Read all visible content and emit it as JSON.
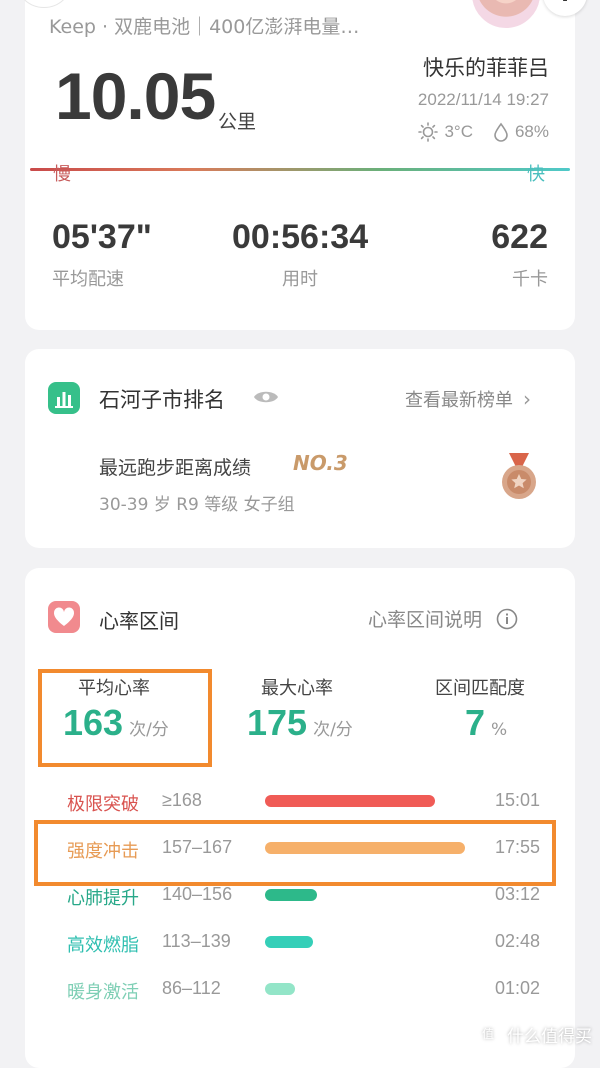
{
  "summary": {
    "sponsor": "Keep · 双鹿电池｜400亿澎湃电量…",
    "distance": "10.05",
    "distance_unit": "公里",
    "user_name": "快乐的菲菲吕",
    "datetime": "2022/11/14 19:27",
    "temperature": "3°C",
    "humidity": "68%",
    "slow_label": "慢",
    "fast_label": "快",
    "stats": [
      {
        "value": "05'37\"",
        "label": "平均配速"
      },
      {
        "value": "00:56:34",
        "label": "用时"
      },
      {
        "value": "622",
        "label": "千卡"
      }
    ]
  },
  "ranking": {
    "title": "石河子市排名",
    "link": "查看最新榜单",
    "achievement": "最远跑步距离成绩",
    "rank_no": "NO.3",
    "group": "30-39 岁 R9 等级 女子组",
    "medal_color": "#c98b6a"
  },
  "heart_rate": {
    "title": "心率区间",
    "help_link": "心率区间说明",
    "avg_label": "平均心率",
    "avg_value": "163",
    "avg_unit": "次/分",
    "max_label": "最大心率",
    "max_value": "175",
    "max_unit": "次/分",
    "match_label": "区间匹配度",
    "match_value": "7",
    "match_unit": "%",
    "zones": [
      {
        "name": "极限突破",
        "range": "≥168",
        "time": "15:01",
        "fraction": 0.85,
        "color": "#f05b56",
        "name_color": "#d9534f"
      },
      {
        "name": "强度冲击",
        "range": "157–167",
        "time": "17:55",
        "fraction": 1.0,
        "color": "#f6b06a",
        "name_color": "#e79b55"
      },
      {
        "name": "心肺提升",
        "range": "140–156",
        "time": "03:12",
        "fraction": 0.26,
        "color": "#2db98a",
        "name_color": "#28a889"
      },
      {
        "name": "高效燃脂",
        "range": "113–139",
        "time": "02:48",
        "fraction": 0.24,
        "color": "#35cfb8",
        "name_color": "#2fbfb0"
      },
      {
        "name": "暖身激活",
        "range": "86–112",
        "time": "01:02",
        "fraction": 0.15,
        "color": "#93e5c8",
        "name_color": "#7fcfb5"
      }
    ]
  },
  "watermark": "什么值得买"
}
